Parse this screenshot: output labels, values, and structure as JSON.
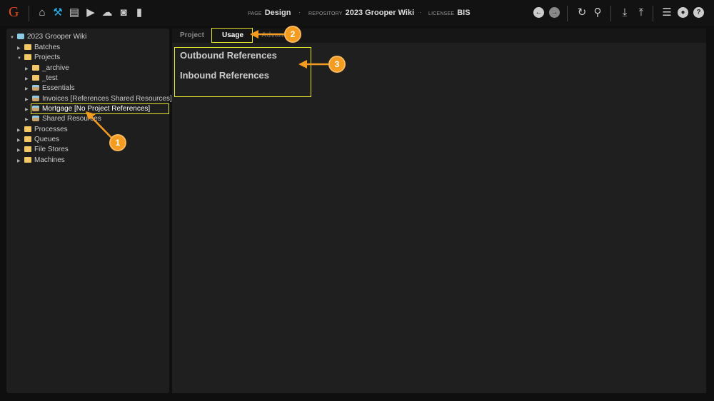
{
  "header": {
    "logo": "G",
    "page_label": "PAGE",
    "page": "Design",
    "repository_label": "REPOSITORY",
    "repository": "2023 Grooper Wiki",
    "licensee_label": "LICENSEE",
    "licensee": "BIS",
    "nav_icons": [
      "home-icon",
      "tools-icon",
      "archive-icon",
      "media-icon",
      "cloud-upload-icon",
      "briefcase-clock-icon",
      "bar-chart-icon"
    ],
    "right_icons": [
      "back-icon",
      "forward-icon",
      "refresh-icon",
      "search-icon",
      "download-icon",
      "upload-icon",
      "database-icon",
      "user-icon",
      "help-icon"
    ]
  },
  "tree": {
    "root": "2023 Grooper Wiki",
    "items": [
      {
        "label": "Batches",
        "type": "folder"
      },
      {
        "label": "Projects",
        "type": "folder"
      },
      {
        "label": "_archive",
        "type": "folder"
      },
      {
        "label": "_test",
        "type": "folder"
      },
      {
        "label": "Essentials",
        "type": "project"
      },
      {
        "label": "Invoices [References Shared Resources]",
        "type": "project"
      },
      {
        "label": "Mortgage [No Project References]",
        "type": "project",
        "selected": true
      },
      {
        "label": "Shared Resources",
        "type": "project"
      },
      {
        "label": "Processes",
        "type": "folder"
      },
      {
        "label": "Queues",
        "type": "folder"
      },
      {
        "label": "File Stores",
        "type": "folder"
      },
      {
        "label": "Machines",
        "type": "folder"
      }
    ]
  },
  "tabs": [
    "Project",
    "Usage",
    "Advanced"
  ],
  "active_tab": "Usage",
  "content": {
    "outbound": "Outbound References",
    "inbound": "Inbound References"
  },
  "callouts": [
    "1",
    "2",
    "3"
  ],
  "colors": {
    "highlight": "#e6e62a",
    "callout": "#f39c1f"
  }
}
